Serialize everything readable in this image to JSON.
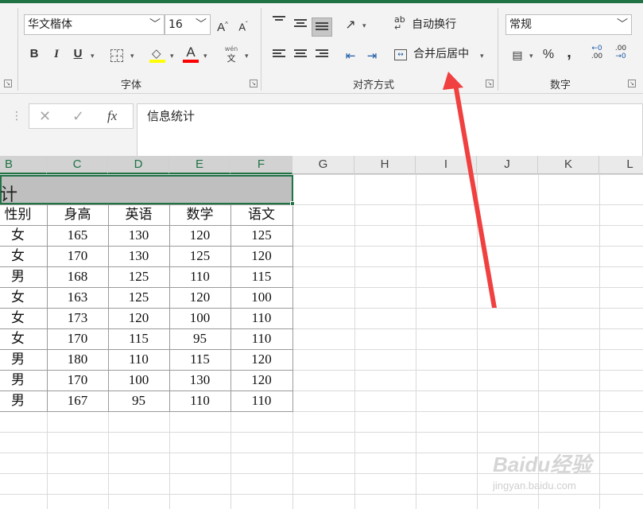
{
  "ribbon": {
    "font_group": {
      "label": "字体",
      "font_name": "华文楷体",
      "font_size": "16",
      "grow_label": "A",
      "shrink_label": "A",
      "bold": "B",
      "italic": "I",
      "underline": "U",
      "font_color_letter": "A",
      "phonetic": "文",
      "fill_color": "#ffff00",
      "font_color": "#ff0000"
    },
    "alignment_group": {
      "label": "对齐方式",
      "wrap_text": "自动换行",
      "merge_center": "合并后居中"
    },
    "number_group": {
      "label": "数字",
      "format": "常规",
      "percent": "%",
      "comma": ",",
      "inc_decimal": ".00",
      "dec_decimal": ".00"
    }
  },
  "formula_bar": {
    "fx": "fx",
    "content": "信息统计"
  },
  "grid": {
    "columns": [
      "B",
      "C",
      "D",
      "E",
      "F",
      "G",
      "H",
      "I",
      "J",
      "K",
      "L"
    ],
    "merged_title": "计",
    "headers": [
      "性别",
      "身高",
      "英语",
      "数学",
      "语文"
    ],
    "rows": [
      [
        "女",
        "165",
        "130",
        "120",
        "125"
      ],
      [
        "女",
        "170",
        "130",
        "125",
        "120"
      ],
      [
        "男",
        "168",
        "125",
        "110",
        "115"
      ],
      [
        "女",
        "163",
        "125",
        "120",
        "100"
      ],
      [
        "女",
        "173",
        "120",
        "100",
        "110"
      ],
      [
        "女",
        "170",
        "115",
        "95",
        "110"
      ],
      [
        "男",
        "180",
        "110",
        "115",
        "120"
      ],
      [
        "男",
        "170",
        "100",
        "130",
        "120"
      ],
      [
        "男",
        "167",
        "95",
        "110",
        "110"
      ]
    ]
  },
  "annotation": {
    "arrow_color": "#f04040"
  },
  "watermark": {
    "logo": "Baidu经验",
    "url": "jingyan.baidu.com"
  }
}
